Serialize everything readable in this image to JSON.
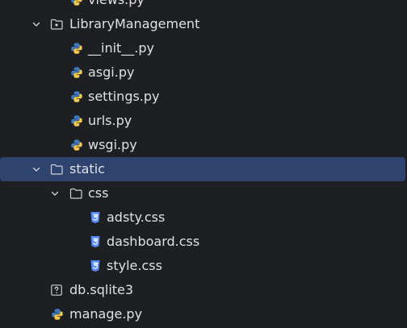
{
  "project_tree": {
    "items": [
      {
        "label": "views.py",
        "icon": "python-file-icon",
        "depth": 3
      },
      {
        "label": "LibraryManagement",
        "icon": "package-folder-icon",
        "depth": 2,
        "expanded": true
      },
      {
        "label": "__init__.py",
        "icon": "python-file-icon",
        "depth": 3
      },
      {
        "label": "asgi.py",
        "icon": "python-file-icon",
        "depth": 3
      },
      {
        "label": "settings.py",
        "icon": "python-file-icon",
        "depth": 3
      },
      {
        "label": "urls.py",
        "icon": "python-file-icon",
        "depth": 3
      },
      {
        "label": "wsgi.py",
        "icon": "python-file-icon",
        "depth": 3
      },
      {
        "label": "static",
        "icon": "folder-icon",
        "depth": 2,
        "expanded": true,
        "selected": true
      },
      {
        "label": "css",
        "icon": "folder-icon",
        "depth": 3,
        "expanded": true
      },
      {
        "label": "adsty.css",
        "icon": "css-file-icon",
        "depth": 4
      },
      {
        "label": "dashboard.css",
        "icon": "css-file-icon",
        "depth": 4
      },
      {
        "label": "style.css",
        "icon": "css-file-icon",
        "depth": 4
      },
      {
        "label": "db.sqlite3",
        "icon": "unknown-file-icon",
        "depth": 2
      },
      {
        "label": "manage.py",
        "icon": "python-file-icon",
        "depth": 2
      }
    ]
  },
  "colors": {
    "background": "#1e1f22",
    "selection": "#2e436e",
    "text": "#dfe1e5",
    "icon_outline": "#ced0d6",
    "python_blue": "#3d7ac2",
    "python_yellow": "#f2c94c",
    "css_blue": "#548af7"
  }
}
